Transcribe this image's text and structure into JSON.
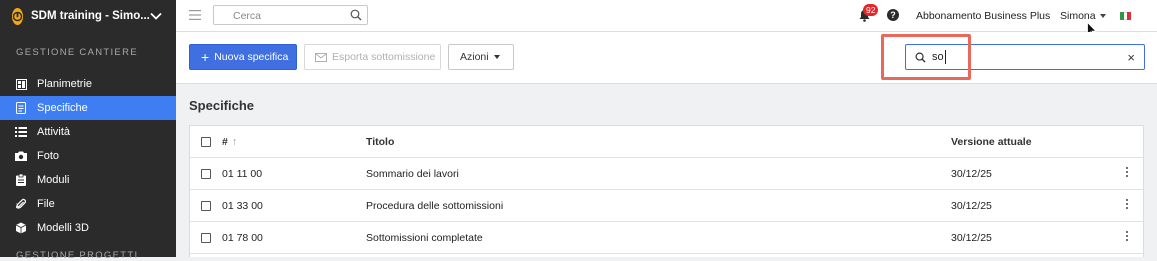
{
  "sidebar": {
    "project_name": "SDM training - Simo...",
    "section_title": "GESTIONE CANTIERE",
    "section_title_2": "GESTIONE PROGETTI",
    "items": [
      {
        "label": "Planimetrie",
        "icon": "floorplan-icon",
        "active": false
      },
      {
        "label": "Specifiche",
        "icon": "document-icon",
        "active": true
      },
      {
        "label": "Attività",
        "icon": "list-icon",
        "active": false
      },
      {
        "label": "Foto",
        "icon": "camera-icon",
        "active": false
      },
      {
        "label": "Moduli",
        "icon": "clipboard-icon",
        "active": false
      },
      {
        "label": "File",
        "icon": "paperclip-icon",
        "active": false
      },
      {
        "label": "Modelli 3D",
        "icon": "cube-icon",
        "active": false
      }
    ]
  },
  "topbar": {
    "search_placeholder": "Cerca",
    "notification_count": "92",
    "help": "?",
    "plan": "Abbonamento Business Plus",
    "user": "Simona",
    "flag_colors": [
      "#2e9a48",
      "#ffffff",
      "#d6303b"
    ]
  },
  "toolbar": {
    "new_button": "Nuova specifica",
    "new_button_plus": "+",
    "export_button": "Esporta sottomissione",
    "actions_button": "Azioni"
  },
  "filter": {
    "value": "so",
    "clear": "×"
  },
  "page_title": "Specifiche",
  "table": {
    "headers": {
      "number": "#",
      "sort": "↑",
      "title": "Titolo",
      "version": "Versione attuale"
    },
    "rows": [
      {
        "number": "01 11 00",
        "title": "Sommario dei lavori",
        "version": "30/12/25"
      },
      {
        "number": "01 33 00",
        "title": "Procedura delle sottomissioni",
        "version": "30/12/25"
      },
      {
        "number": "01 78 00",
        "title": "Sottomissioni completate",
        "version": "30/12/25"
      }
    ]
  },
  "colors": {
    "sidebar_bg": "#2b2b2b",
    "accent": "#3f7ef2",
    "badge": "#e3262a",
    "highlight": "#e8685c"
  }
}
